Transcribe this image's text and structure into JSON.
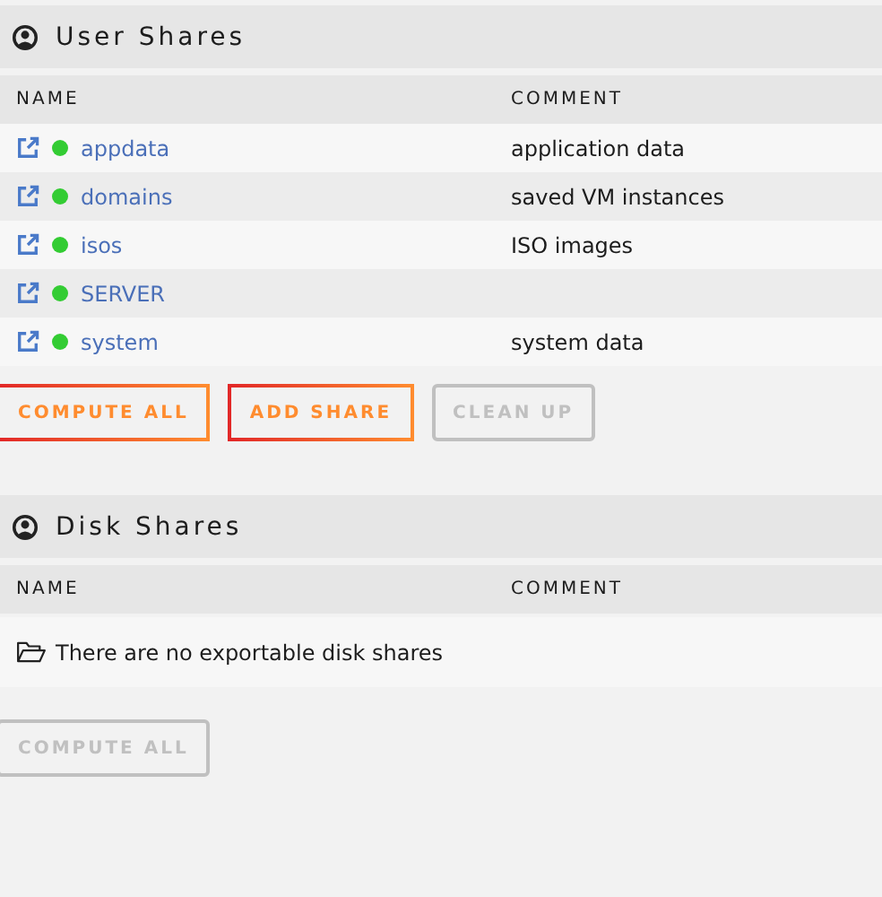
{
  "user_shares": {
    "title": "User Shares",
    "columns": [
      "NAME",
      "COMMENT"
    ],
    "rows": [
      {
        "name": "appdata",
        "comment": "application data",
        "color": "#33cc33"
      },
      {
        "name": "domains",
        "comment": "saved VM instances",
        "color": "#33cc33"
      },
      {
        "name": "isos",
        "comment": "ISO images",
        "color": "#33cc33"
      },
      {
        "name": "SERVER",
        "color": "#33cc33"
      },
      {
        "name": "system",
        "comment": "system data",
        "color": "#33cc33"
      }
    ],
    "buttons": [
      {
        "label": "COMPUTE ALL",
        "disabled": false
      },
      {
        "label": "ADD SHARE",
        "disabled": false
      },
      {
        "label": "CLEAN UP",
        "disabled": true
      }
    ]
  },
  "disk_shares": {
    "title": "Disk Shares",
    "columns": [
      "NAME",
      "COMMENT"
    ],
    "empty_message": "There are no exportable disk shares",
    "buttons": [
      {
        "label": "COMPUTE ALL",
        "disabled": true
      }
    ]
  }
}
